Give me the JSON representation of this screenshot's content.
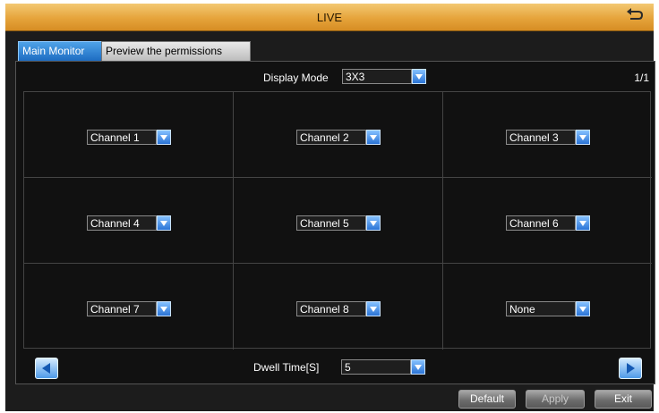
{
  "window": {
    "title": "LIVE"
  },
  "tabs": [
    {
      "label": "Main Monitor",
      "active": true
    },
    {
      "label": "Preview the permissions",
      "active": false
    }
  ],
  "display_mode": {
    "label": "Display Mode",
    "value": "3X3"
  },
  "page_indicator": "1/1",
  "channels": [
    "Channel 1",
    "Channel 2",
    "Channel 3",
    "Channel 4",
    "Channel 5",
    "Channel 6",
    "Channel 7",
    "Channel 8",
    "None"
  ],
  "dwell": {
    "label": "Dwell Time[S]",
    "value": "5"
  },
  "buttons": {
    "default": "Default",
    "apply": "Apply",
    "exit": "Exit"
  },
  "colors": {
    "title_bar": "#e6a43b",
    "accent": "#2b74d6",
    "background": "#1c1c1c"
  }
}
